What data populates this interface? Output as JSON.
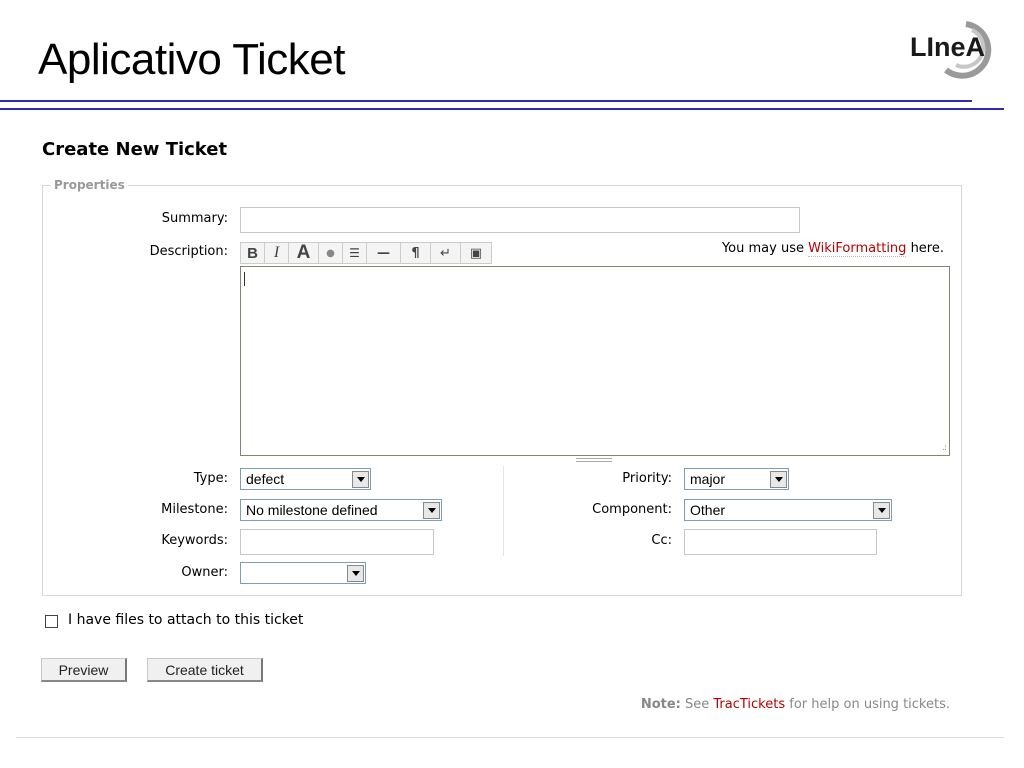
{
  "slide": {
    "title": "Aplicativo Ticket",
    "logo_text": "LineA"
  },
  "form": {
    "heading": "Create New Ticket",
    "legend": "Properties",
    "summary": {
      "label": "Summary:",
      "value": ""
    },
    "description": {
      "label": "Description:",
      "hint_prefix": "You may use ",
      "hint_link": "WikiFormatting",
      "hint_suffix": " here.",
      "value": ""
    },
    "toolbar": [
      {
        "name": "bold-icon",
        "glyph": "B"
      },
      {
        "name": "italic-icon",
        "glyph": "I"
      },
      {
        "name": "heading-icon",
        "glyph": "A"
      },
      {
        "name": "link-icon",
        "glyph": "●"
      },
      {
        "name": "code-icon",
        "glyph": "☰"
      },
      {
        "name": "hr-icon",
        "glyph": "—"
      },
      {
        "name": "paragraph-icon",
        "glyph": "¶"
      },
      {
        "name": "linebreak-icon",
        "glyph": "↵"
      },
      {
        "name": "image-icon",
        "glyph": "▣"
      }
    ],
    "type": {
      "label": "Type:",
      "value": "defect"
    },
    "priority": {
      "label": "Priority:",
      "value": "major"
    },
    "milestone": {
      "label": "Milestone:",
      "value": "No milestone defined"
    },
    "component": {
      "label": "Component:",
      "value": "Other"
    },
    "keywords": {
      "label": "Keywords:",
      "value": ""
    },
    "cc": {
      "label": "Cc:",
      "value": ""
    },
    "owner": {
      "label": "Owner:",
      "value": ""
    }
  },
  "attach": {
    "label": "I have files to attach to this ticket",
    "checked": false
  },
  "buttons": {
    "preview": "Preview",
    "create": "Create ticket"
  },
  "note": {
    "bold": "Note:",
    "prefix": " See ",
    "link": "TracTickets",
    "suffix": " for help on using tickets."
  },
  "colors": {
    "rule": "#2b2bb5",
    "link": "#bb0000",
    "logo": "#1a1a1a"
  }
}
